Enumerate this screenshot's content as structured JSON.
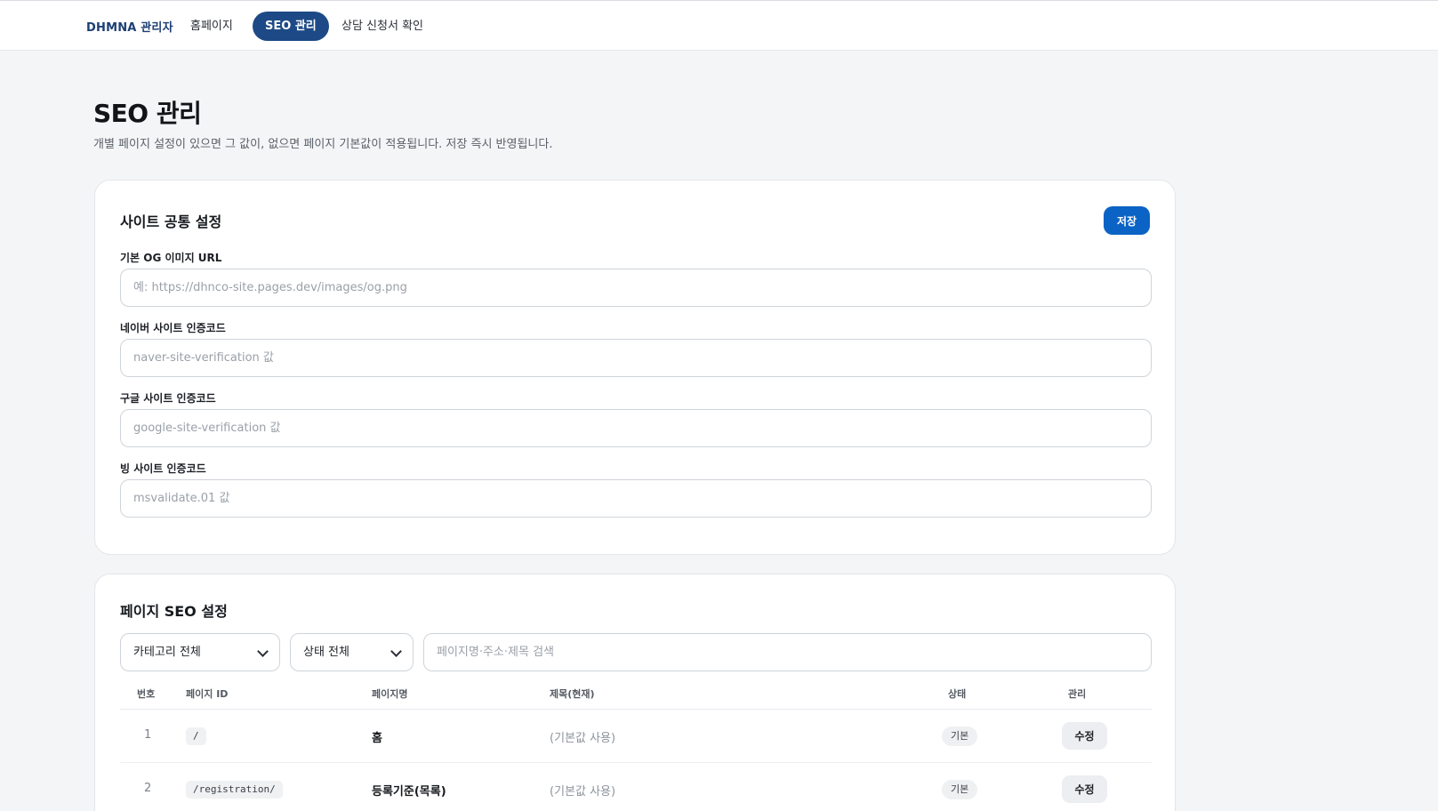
{
  "nav": {
    "brand": "DHMNA 관리자",
    "items": [
      {
        "label": "홈페이지",
        "active": false
      },
      {
        "label": "SEO 관리",
        "active": true
      },
      {
        "label": "상담 신청서 확인",
        "active": false
      }
    ]
  },
  "page": {
    "title": "SEO 관리",
    "description": "개별 페이지 설정이 있으면 그 값이, 없으면 페이지 기본값이 적용됩니다. 저장 즉시 반영됩니다."
  },
  "site_settings": {
    "title": "사이트 공통 설정",
    "save_label": "저장",
    "fields": [
      {
        "label": "기본 OG 이미지 URL",
        "value": "",
        "placeholder": "예: https://dhnco-site.pages.dev/images/og.png"
      },
      {
        "label": "네이버 사이트 인증코드",
        "value": "",
        "placeholder": "naver-site-verification 값"
      },
      {
        "label": "구글 사이트 인증코드",
        "value": "",
        "placeholder": "google-site-verification 값"
      },
      {
        "label": "빙 사이트 인증코드",
        "value": "",
        "placeholder": "msvalidate.01 값"
      }
    ]
  },
  "page_seo": {
    "title": "페이지 SEO 설정",
    "category_filter": "카테고리 전체",
    "status_filter": "상태 전체",
    "search_placeholder": "페이지명·주소·제목 검색",
    "columns": [
      "번호",
      "페이지 ID",
      "페이지명",
      "제목(현재)",
      "상태",
      "관리"
    ],
    "rows": [
      {
        "num": "1",
        "id": "/",
        "name": "홈",
        "title": "(기본값 사용)",
        "status": "기본",
        "action": "수정"
      },
      {
        "num": "2",
        "id": "/registration/",
        "name": "등록기준(목록)",
        "title": "(기본값 사용)",
        "status": "기본",
        "action": "수정"
      }
    ]
  },
  "colors": {
    "accent": "#0b63c5",
    "nav_active": "#1d4a86",
    "brand": "#1d3f73"
  }
}
